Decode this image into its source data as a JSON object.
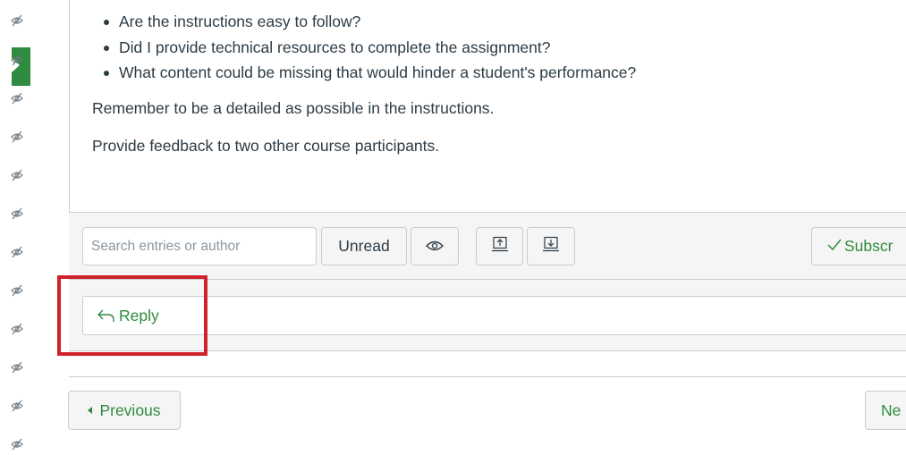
{
  "sidebar": {
    "icon_name": "hidden-eye-icon",
    "active_color": "#2e8b3f"
  },
  "post": {
    "bullets": [
      "Are the instructions easy to follow?",
      "Did I provide technical resources to complete the assignment?",
      "What content could be missing that would hinder a student's performance?"
    ],
    "paragraph_1": "Remember to be a detailed as possible in the instructions.",
    "paragraph_2": "Provide feedback to two other course participants."
  },
  "toolbar": {
    "search_placeholder": "Search entries or author",
    "unread_label": "Unread",
    "subscribe_label": "Subscr"
  },
  "reply": {
    "label": "Reply"
  },
  "pager": {
    "previous_label": "Previous",
    "next_label": "Ne"
  },
  "colors": {
    "accent": "#2e8b3f",
    "highlight": "#d1222b",
    "text": "#2d3b45",
    "border": "#c7cdd1"
  }
}
